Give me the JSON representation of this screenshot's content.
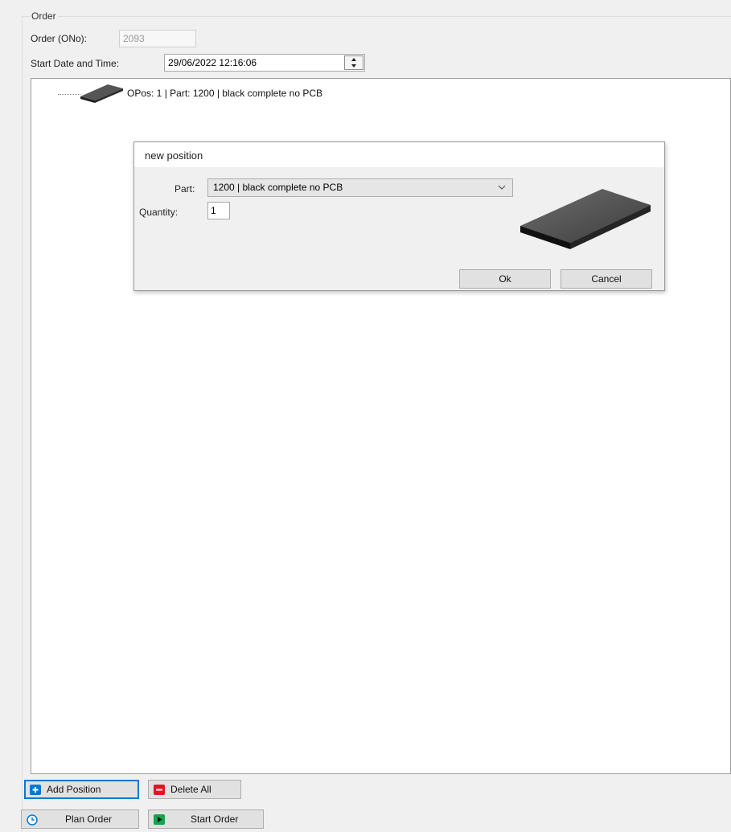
{
  "order_group": {
    "title": "Order",
    "order_no_label": "Order (ONo):",
    "order_no_value": "2093",
    "start_label": "Start Date and Time:",
    "start_value": "29/06/2022 12:16:06"
  },
  "tree": {
    "items": [
      {
        "label": "OPos: 1 | Part: 1200 | black complete no PCB",
        "icon": "black-part-icon"
      }
    ]
  },
  "dialog": {
    "title": "new position",
    "part_label": "Part:",
    "part_value": "1200 | black complete no PCB",
    "quantity_label": "Quantity:",
    "quantity_value": "1",
    "ok_label": "Ok",
    "cancel_label": "Cancel",
    "preview_icon": "part-preview-image"
  },
  "toolbar": {
    "add_position_label": "Add Position",
    "delete_all_label": "Delete All",
    "plan_order_label": "Plan Order",
    "start_order_label": "Start Order"
  },
  "icons": {
    "add": "plus-icon",
    "delete": "minus-icon",
    "plan": "clock-icon",
    "start": "play-icon"
  },
  "colors": {
    "accent_blue": "#0078d7",
    "delete_red": "#e81123",
    "start_green": "#16a34a",
    "part_dark": "#3a3a3a"
  }
}
